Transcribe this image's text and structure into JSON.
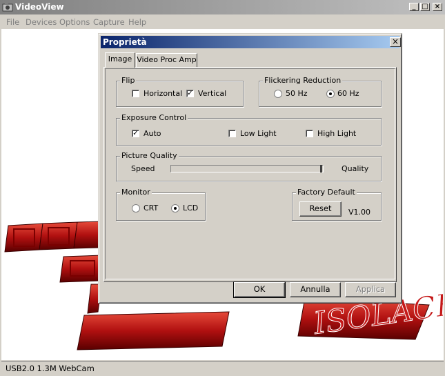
{
  "window": {
    "title": "VideoView",
    "menu": [
      "File",
      "Devices",
      "Options",
      "Capture",
      "Help"
    ],
    "status": "USB2.0 1.3M WebCam"
  },
  "background_logo_text": "ISOLACHE",
  "dialog": {
    "title": "Proprietà",
    "close_glyph": "×",
    "tabs": [
      "Image",
      "Video Proc Amp"
    ],
    "flip": {
      "legend": "Flip",
      "horizontal": {
        "label": "Horizontal",
        "checked": false
      },
      "vertical": {
        "label": "Vertical",
        "checked": true
      }
    },
    "flicker": {
      "legend": "Flickering Reduction",
      "options": [
        {
          "label": "50 Hz",
          "selected": false
        },
        {
          "label": "60 Hz",
          "selected": true
        }
      ]
    },
    "exposure": {
      "legend": "Exposure Control",
      "options": [
        {
          "label": "Auto",
          "checked": true
        },
        {
          "label": "Low Light",
          "checked": false
        },
        {
          "label": "High Light",
          "checked": false
        }
      ]
    },
    "quality": {
      "legend": "Picture Quality",
      "left_label": "Speed",
      "right_label": "Quality",
      "value": 1.0
    },
    "monitor": {
      "legend": "Monitor",
      "options": [
        {
          "label": "CRT",
          "selected": false
        },
        {
          "label": "LCD",
          "selected": true
        }
      ]
    },
    "factory": {
      "legend": "Factory Default",
      "reset_label": "Reset",
      "version": "V1.00"
    },
    "buttons": {
      "ok": "OK",
      "cancel": "Annulla",
      "apply": "Applica"
    }
  }
}
